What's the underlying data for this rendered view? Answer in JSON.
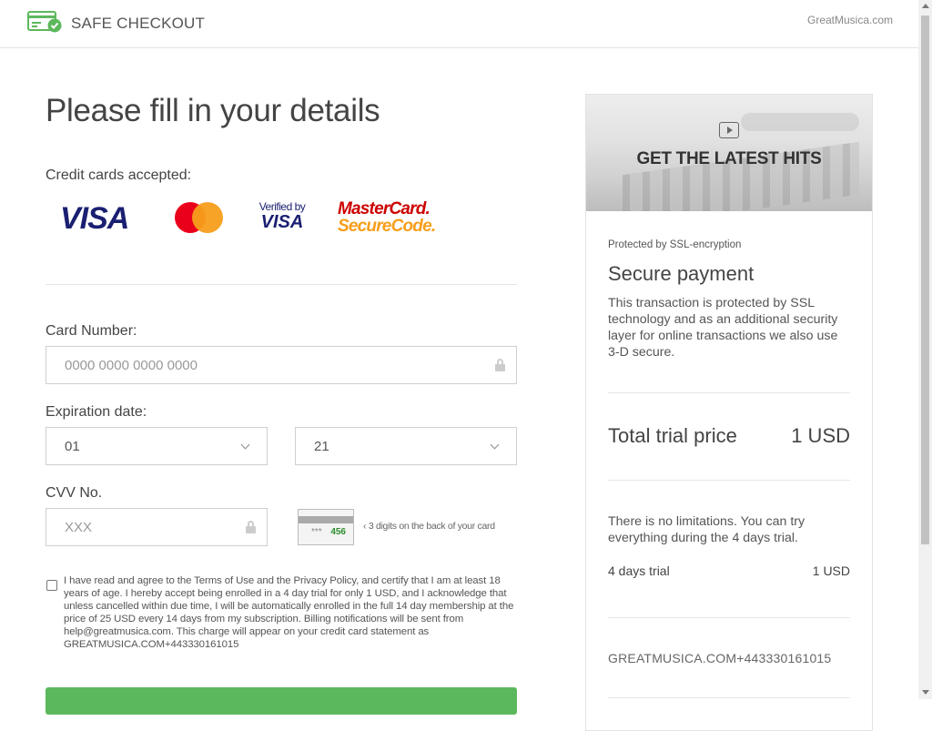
{
  "header": {
    "brand": "SAFE CHECKOUT",
    "site_link": "GreatMusica.com"
  },
  "form": {
    "title": "Please fill in your details",
    "cards_label": "Credit cards accepted:",
    "card_logos": {
      "visa": "VISA",
      "verified_by_visa_line1": "Verified by",
      "verified_by_visa_line2": "VISA",
      "securecode_line1": "MasterCard.",
      "securecode_line2": "SecureCode."
    },
    "card_number_label": "Card Number:",
    "card_number_placeholder": "0000 0000 0000 0000",
    "expiration_label": "Expiration date:",
    "exp_month": "01",
    "exp_year": "21",
    "cvv_label": "CVV No.",
    "cvv_placeholder": "XXX",
    "cvv_image_stars": "***",
    "cvv_image_digits": "456",
    "cvv_hint": "3 digits on the back of your card",
    "terms_text": "I have read and agree to the Terms of Use and the Privacy Policy, and certify that I am at least 18 years of age. I hereby accept being enrolled in a 4 day trial for only 1 USD, and I acknowledge that unless cancelled within due time, I will be automatically enrolled in the full 14 day membership at the price of 25 USD every 14 days from my subscription. Billing notifications will be sent from help@greatmusica.com. This charge will appear on your credit card statement as GREATMUSICA.COM+443330161015",
    "terms_checked": false
  },
  "sidebar": {
    "banner_title": "GET THE LATEST HITS",
    "ssl_small": "Protected by SSL-encryption",
    "secure_title": "Secure payment",
    "secure_text": "This transaction is protected by SSL technology and as an additional security layer for online transactions we also use 3-D secure.",
    "total_label": "Total trial price",
    "total_value": "1 USD",
    "no_limit_text": "There is no limitations. You can try everything during the 4 days trial.",
    "trial_label": "4 days trial",
    "trial_value": "1 USD",
    "descriptor": "GREATMUSICA.COM+443330161015"
  },
  "colors": {
    "brand_green": "#5cb85c",
    "visa_blue": "#1a1f71",
    "mc_red": "#eb001b",
    "mc_orange": "#f79e1b"
  },
  "icons": [
    "checkout-card-check-icon",
    "lock-icon",
    "chevron-down-icon",
    "play-icon",
    "chevron-left-icon"
  ]
}
